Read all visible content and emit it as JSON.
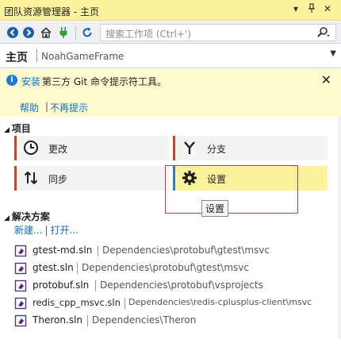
{
  "window": {
    "title": "团队资源管理器 - 主页",
    "buttons": {
      "menu": "▾",
      "pin": "ᵖ",
      "close": "✕"
    }
  },
  "toolbar": {
    "icons": [
      "back-icon",
      "forward-icon",
      "home-icon",
      "connect-icon",
      "refresh-icon"
    ],
    "search_placeholder": "搜索工作项 (Ctrl+')",
    "search_icon": "search-icon"
  },
  "breadcrumb": {
    "page": "主页",
    "project": "NoahGameFrame"
  },
  "info_bar": {
    "link": "安装",
    "message": "第三方 Git 命令提示符工具。",
    "help": "帮助",
    "separator": "|",
    "dismiss": "不再提示"
  },
  "project_section": {
    "title": "项目",
    "tiles": [
      {
        "label": "更改",
        "icon": "clock-icon"
      },
      {
        "label": "分支",
        "icon": "branch-icon"
      },
      {
        "label": "同步",
        "icon": "sync-icon"
      },
      {
        "label": "设置",
        "icon": "gear-icon"
      }
    ],
    "tooltip": "设置"
  },
  "solutions_section": {
    "title": "解决方案",
    "new": "新建...",
    "separator": "|",
    "open": "打开...",
    "items": [
      {
        "name": "gtest-md.sln",
        "path": "Dependencies\\protobuf\\gtest\\msvc"
      },
      {
        "name": "gtest.sln",
        "path": "Dependencies\\protobuf\\gtest\\msvc"
      },
      {
        "name": "protobuf.sln",
        "path": "Dependencies\\protobuf\\vsprojects"
      },
      {
        "name": "redis_cpp_msvc.sln",
        "path": "Dependencies\\redis-cplusplus-client\\msvc"
      },
      {
        "name": "Theron.sln",
        "path": "Dependencies\\Theron"
      }
    ]
  },
  "colors": {
    "title_bg": "#fff29d",
    "info_bg": "#fffacd",
    "link": "#0e70c0",
    "tile_accent": "#c8462a",
    "selected_accent": "#2c7fc8",
    "highlight_box": "#c73a36"
  }
}
